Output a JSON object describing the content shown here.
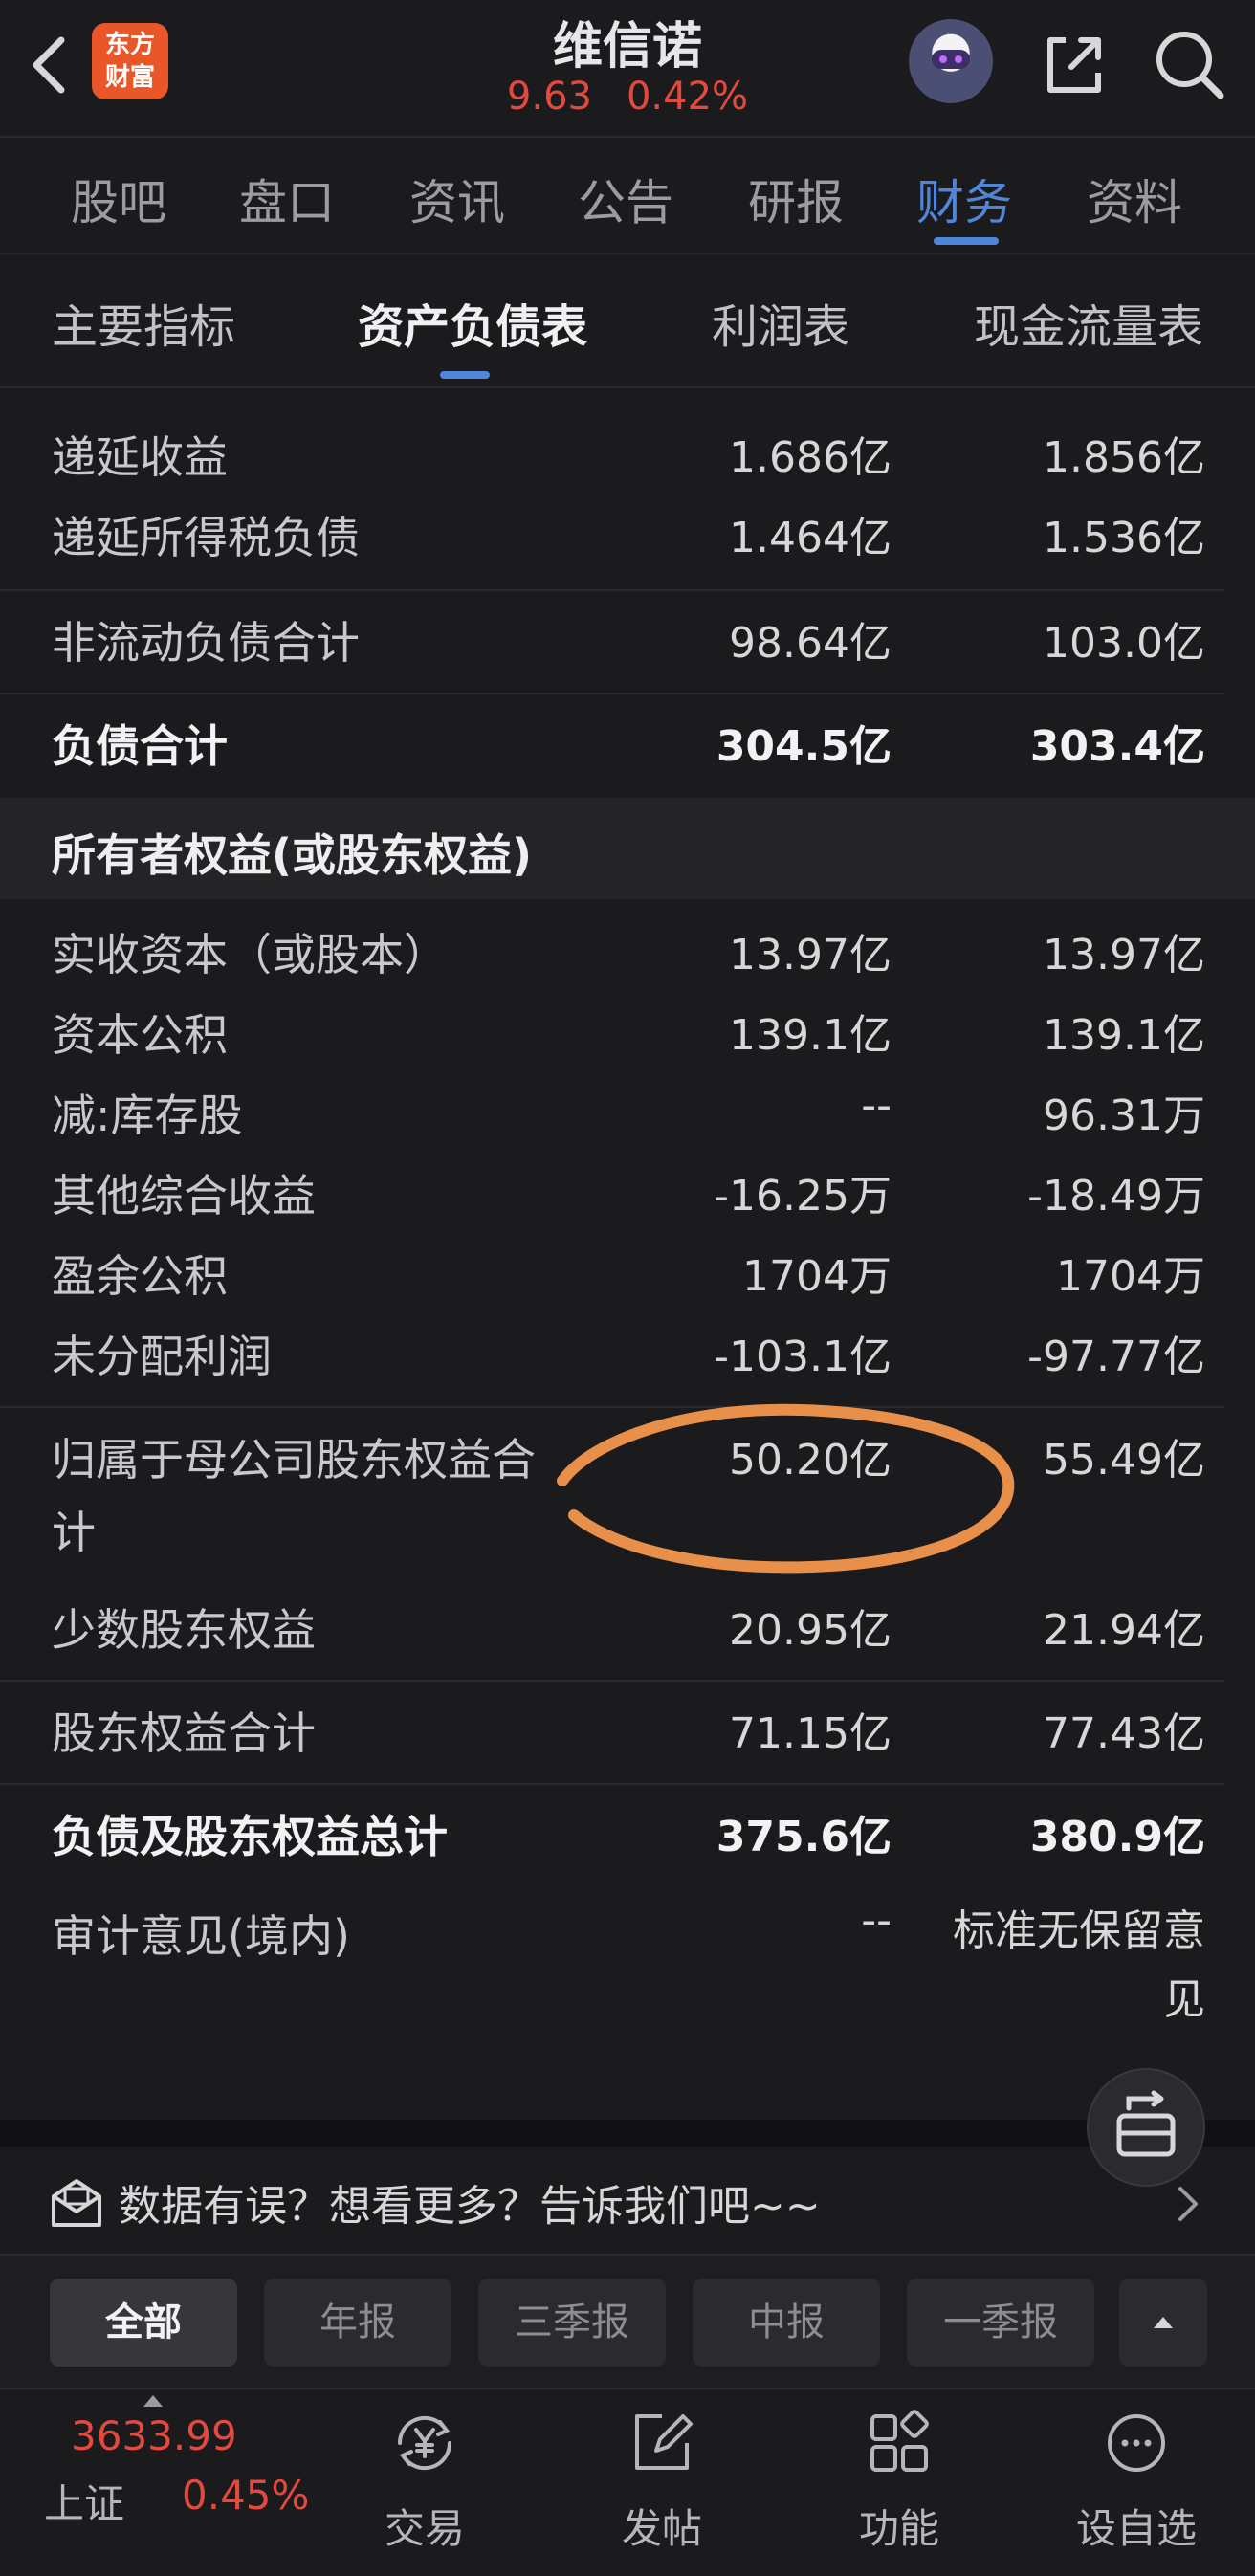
{
  "header": {
    "title": "维信诺",
    "price": "9.63",
    "change_pct": "0.42%",
    "logo_line1": "东方",
    "logo_line2": "财富"
  },
  "main_tabs": [
    "股吧",
    "盘口",
    "资讯",
    "公告",
    "研报",
    "财务",
    "资料"
  ],
  "main_tab_active": "财务",
  "sub_tabs": [
    "主要指标",
    "资产负债表",
    "利润表",
    "现金流量表"
  ],
  "sub_tab_active": "资产负债表",
  "rows": {
    "deferred_income": {
      "label": "递延收益",
      "v1": "1.686亿",
      "v2": "1.856亿"
    },
    "deferred_tax_liab": {
      "label": "递延所得税负债",
      "v1": "1.464亿",
      "v2": "1.536亿"
    },
    "noncurrent_liab_total": {
      "label": "非流动负债合计",
      "v1": "98.64亿",
      "v2": "103.0亿"
    },
    "liab_total": {
      "label": "负债合计",
      "v1": "304.5亿",
      "v2": "303.4亿"
    },
    "equity_section": {
      "label": "所有者权益(或股东权益)"
    },
    "paid_in_capital": {
      "label": "实收资本（或股本）",
      "v1": "13.97亿",
      "v2": "13.97亿"
    },
    "capital_reserve": {
      "label": "资本公积",
      "v1": "139.1亿",
      "v2": "139.1亿"
    },
    "treasury_stock": {
      "label": "减:库存股",
      "v1": "--",
      "v2": "96.31万"
    },
    "oci": {
      "label": "其他综合收益",
      "v1": "-16.25万",
      "v2": "-18.49万"
    },
    "surplus_reserve": {
      "label": "盈余公积",
      "v1": "1704万",
      "v2": "1704万"
    },
    "undistributed_profit": {
      "label": "未分配利润",
      "v1": "-103.1亿",
      "v2": "-97.77亿"
    },
    "parent_equity_total": {
      "label_line1": "归属于母公司股东权益合",
      "label_line2": "计",
      "v1": "50.20亿",
      "v2": "55.49亿"
    },
    "minority_equity": {
      "label": "少数股东权益",
      "v1": "20.95亿",
      "v2": "21.94亿"
    },
    "equity_total": {
      "label": "股东权益合计",
      "v1": "71.15亿",
      "v2": "77.43亿"
    },
    "liab_equity_total": {
      "label": "负债及股东权益总计",
      "v1": "375.6亿",
      "v2": "380.9亿"
    },
    "audit_opinion": {
      "label": "审计意见(境内)",
      "v1": "--",
      "v2_line1": "标准无保留意",
      "v2_line2": "见"
    }
  },
  "feedback": {
    "text": "数据有误？想看更多？告诉我们吧~~"
  },
  "filters": [
    "全部",
    "年报",
    "三季报",
    "中报",
    "一季报"
  ],
  "filter_active": "全部",
  "bottom_nav": {
    "index_value": "3633.99",
    "index_name": "上证",
    "index_pct": "0.45%",
    "items": [
      "交易",
      "发帖",
      "功能",
      "设自选"
    ]
  },
  "colors": {
    "accent": "#4f86d9",
    "up": "#e3493f",
    "annotation": "#e8904a"
  }
}
